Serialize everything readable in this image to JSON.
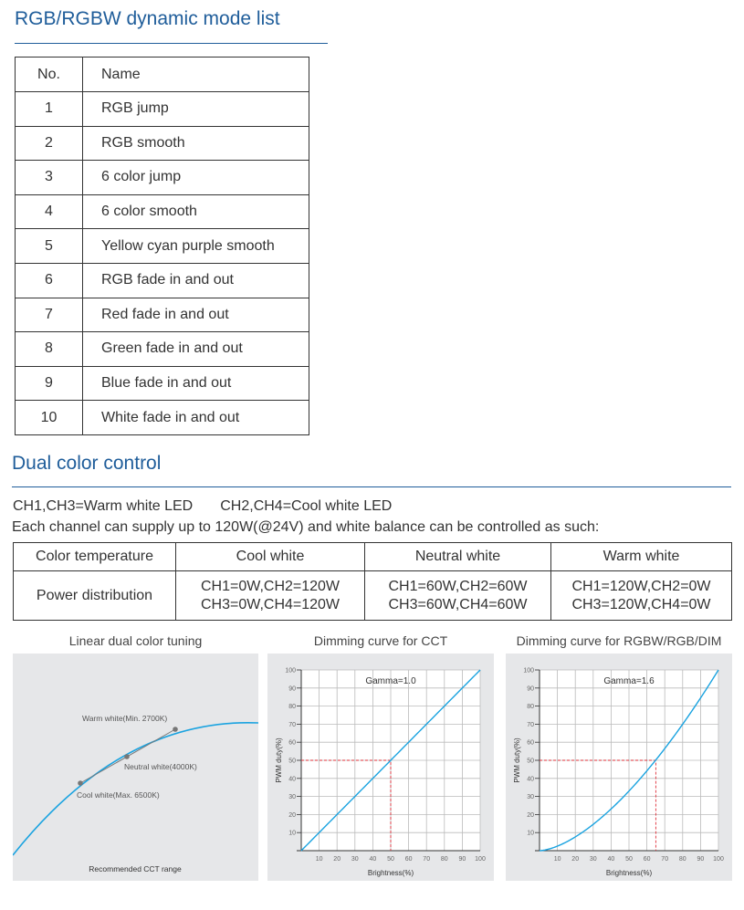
{
  "mode_list": {
    "title": "RGB/RGBW dynamic mode list",
    "headers": [
      "No.",
      "Name"
    ],
    "rows": [
      [
        "1",
        "RGB jump"
      ],
      [
        "2",
        "RGB smooth"
      ],
      [
        "3",
        "6 color jump"
      ],
      [
        "4",
        "6 color smooth"
      ],
      [
        "5",
        "Yellow cyan purple smooth"
      ],
      [
        "6",
        "RGB fade in and out"
      ],
      [
        "7",
        "Red fade in and out"
      ],
      [
        "8",
        "Green fade in and out"
      ],
      [
        "9",
        "Blue fade in and out"
      ],
      [
        "10",
        "White fade in and out"
      ]
    ]
  },
  "dual": {
    "title": "Dual color control",
    "line1a": "CH1,CH3=Warm white LED",
    "line1b": "CH2,CH4=Cool white LED",
    "line2": "Each channel can supply up to 120W(@24V) and white balance can be controlled as such:",
    "table": {
      "row1": [
        "Color temperature",
        "Cool white",
        "Neutral white",
        "Warm white"
      ],
      "row2_label": "Power distribution",
      "cells": [
        [
          "CH1=0W,CH2=120W",
          "CH3=0W,CH4=120W"
        ],
        [
          "CH1=60W,CH2=60W",
          "CH3=60W,CH4=60W"
        ],
        [
          "CH1=120W,CH2=0W",
          "CH3=120W,CH4=0W"
        ]
      ]
    }
  },
  "diagram": {
    "title": "Linear dual color tuning",
    "warm": "Warm white(Min. 2700K)",
    "neutral": "Neutral white(4000K)",
    "cool": "Cool white(Max. 6500K)",
    "footer": "Recommended CCT range"
  },
  "chart_data": [
    {
      "type": "line",
      "title": "Dimming curve for CCT",
      "annotation": "Gamma=1.0",
      "gamma": 1.0,
      "xlabel": "Brightness(%)",
      "ylabel": "PWM duty(%)",
      "xlim": [
        0,
        100
      ],
      "ylim": [
        0,
        100
      ],
      "ticks": [
        "10",
        "20",
        "30",
        "40",
        "50",
        "60",
        "70",
        "80",
        "90",
        "100"
      ],
      "grid": true,
      "marker": {
        "x": 50,
        "y": 50
      }
    },
    {
      "type": "line",
      "title": "Dimming curve for RGBW/RGB/DIM",
      "annotation": "Gamma=1.6",
      "gamma": 1.6,
      "xlabel": "Brightness(%)",
      "ylabel": "PWM duty(%)",
      "xlim": [
        0,
        100
      ],
      "ylim": [
        0,
        100
      ],
      "ticks": [
        "10",
        "20",
        "30",
        "40",
        "50",
        "60",
        "70",
        "80",
        "90",
        "100"
      ],
      "grid": true,
      "marker": {
        "x": 65,
        "y": 50
      }
    }
  ],
  "colors": {
    "heading": "#1f5d9a",
    "curve": "#1aa3e0",
    "marker": "#e0303a",
    "panel": "#e6e7e9"
  }
}
